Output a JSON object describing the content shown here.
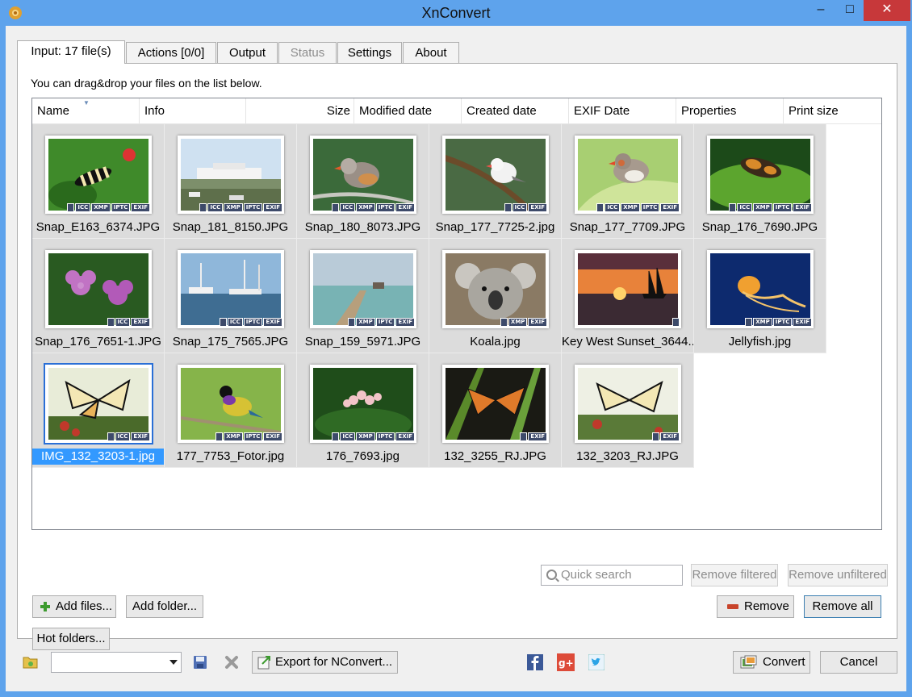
{
  "window": {
    "title": "XnConvert",
    "minimize": "–",
    "maximize": "□",
    "close": "✕"
  },
  "tabs": [
    {
      "label": "Input: 17 file(s)",
      "state": "active"
    },
    {
      "label": "Actions [0/0]",
      "state": "normal"
    },
    {
      "label": "Output",
      "state": "normal"
    },
    {
      "label": "Status",
      "state": "disabled"
    },
    {
      "label": "Settings",
      "state": "normal"
    },
    {
      "label": "About",
      "state": "normal"
    }
  ],
  "input": {
    "hint": "You can drag&drop your files on the list below.",
    "columns": [
      "Name",
      "Info",
      "Size",
      "Modified date",
      "Created date",
      "EXIF Date",
      "Properties",
      "Print size"
    ],
    "files": [
      {
        "name": "Snap_E163_6374.JPG",
        "badges": [
          "ICC",
          "XMP",
          "IPTC",
          "EXIF"
        ],
        "selected": false,
        "icon": "zebra-butterfly"
      },
      {
        "name": "Snap_181_8150.JPG",
        "badges": [
          "ICC",
          "XMP",
          "IPTC",
          "EXIF"
        ],
        "selected": false,
        "icon": "cruise-ship-harbor"
      },
      {
        "name": "Snap_180_8073.JPG",
        "badges": [
          "ICC",
          "XMP",
          "IPTC",
          "EXIF"
        ],
        "selected": false,
        "icon": "finch-bird"
      },
      {
        "name": "Snap_177_7725-2.jpg",
        "badges": [
          "ICC",
          "EXIF"
        ],
        "selected": false,
        "icon": "white-bird"
      },
      {
        "name": "Snap_177_7709.JPG",
        "badges": [
          "ICC",
          "XMP",
          "IPTC",
          "EXIF"
        ],
        "selected": false,
        "icon": "zebra-finch"
      },
      {
        "name": "Snap_176_7690.JPG",
        "badges": [
          "ICC",
          "XMP",
          "IPTC",
          "EXIF"
        ],
        "selected": false,
        "icon": "butterfly-leaf"
      },
      {
        "name": "Snap_176_7651-1.JPG",
        "badges": [
          "ICC",
          "EXIF"
        ],
        "selected": false,
        "icon": "purple-orchids"
      },
      {
        "name": "Snap_175_7565.JPG",
        "badges": [
          "ICC",
          "IPTC",
          "EXIF"
        ],
        "selected": false,
        "icon": "marina-boats"
      },
      {
        "name": "Snap_159_5971.JPG",
        "badges": [
          "XMP",
          "IPTC",
          "EXIF"
        ],
        "selected": false,
        "icon": "pier-sea"
      },
      {
        "name": "Koala.jpg",
        "badges": [
          "XMP",
          "EXIF"
        ],
        "selected": false,
        "icon": "koala"
      },
      {
        "name": "Key West Sunset_3644...",
        "badges": [],
        "selected": false,
        "icon": "sunset-ship"
      },
      {
        "name": "Jellyfish.jpg",
        "badges": [
          "XMP",
          "IPTC",
          "EXIF"
        ],
        "selected": false,
        "icon": "jellyfish"
      },
      {
        "name": "IMG_132_3203-1.jpg",
        "badges": [
          "ICC",
          "EXIF"
        ],
        "selected": true,
        "icon": "monarch-butterfly"
      },
      {
        "name": "177_7753_Fotor.jpg",
        "badges": [
          "XMP",
          "IPTC",
          "EXIF"
        ],
        "selected": false,
        "icon": "gouldian-finch"
      },
      {
        "name": "176_7693.jpg",
        "badges": [
          "ICC",
          "XMP",
          "IPTC",
          "EXIF"
        ],
        "selected": false,
        "icon": "pink-flowers"
      },
      {
        "name": "132_3255_RJ.JPG",
        "badges": [
          "EXIF"
        ],
        "selected": false,
        "icon": "orange-butterfly"
      },
      {
        "name": "132_3203_RJ.JPG",
        "badges": [
          "EXIF"
        ],
        "selected": false,
        "icon": "monarch-butterfly-2"
      }
    ],
    "quick_search_placeholder": "Quick search",
    "remove_filtered": "Remove filtered",
    "remove_unfiltered": "Remove unfiltered",
    "add_files": "Add files...",
    "add_folder": "Add folder...",
    "remove": "Remove",
    "remove_all": "Remove all",
    "hot_folders": "Hot folders..."
  },
  "footer": {
    "preset_value": "",
    "export": "Export for NConvert...",
    "convert": "Convert",
    "cancel": "Cancel"
  },
  "colors": {
    "titlebar": "#5ea3ec",
    "selection": "#3399ff",
    "close": "#c7383a"
  }
}
